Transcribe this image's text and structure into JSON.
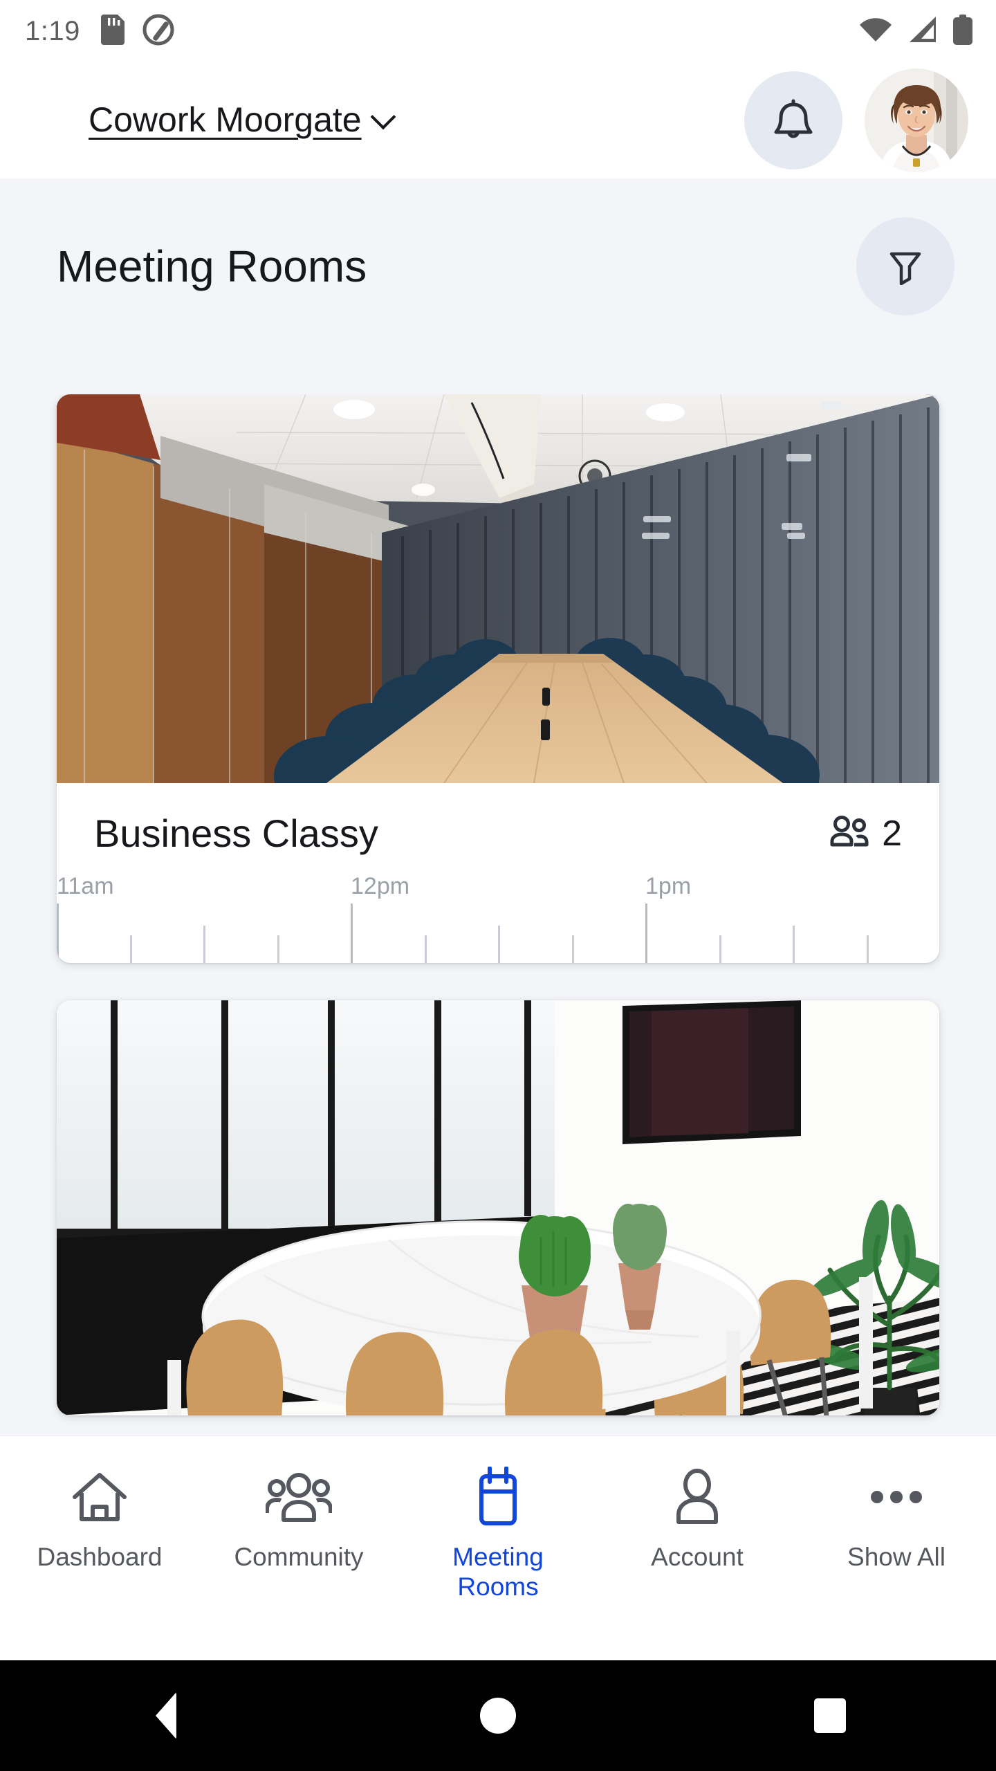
{
  "status_bar": {
    "time": "1:19",
    "left_icons": [
      "sd-card-icon",
      "adaptive-icon"
    ],
    "right_icons": [
      "wifi-icon",
      "cellular-signal-icon",
      "battery-icon"
    ]
  },
  "header": {
    "venue_name": "Cowork Moorgate",
    "chevron": "chevron-down-icon",
    "notifications_icon": "bell-icon",
    "avatar_alt": "user-avatar"
  },
  "page": {
    "title": "Meeting Rooms",
    "filter_icon": "filter-funnel-icon"
  },
  "rooms": [
    {
      "name": "Business Classy",
      "capacity": "2",
      "capacity_icon": "people-icon",
      "photo": "boardroom-wood-table-navy-chairs",
      "timeline": {
        "labels": [
          "11am",
          "12pm",
          "1pm"
        ],
        "label_positions_pct": [
          0,
          33.33,
          66.66
        ],
        "ticks": [
          {
            "pos_pct": 0,
            "size": "major"
          },
          {
            "pos_pct": 8.33,
            "size": "minor"
          },
          {
            "pos_pct": 16.66,
            "size": "mid"
          },
          {
            "pos_pct": 25,
            "size": "minor"
          },
          {
            "pos_pct": 33.33,
            "size": "major"
          },
          {
            "pos_pct": 41.66,
            "size": "minor"
          },
          {
            "pos_pct": 50,
            "size": "mid"
          },
          {
            "pos_pct": 58.33,
            "size": "minor"
          },
          {
            "pos_pct": 66.66,
            "size": "major"
          },
          {
            "pos_pct": 75,
            "size": "minor"
          },
          {
            "pos_pct": 83.33,
            "size": "mid"
          },
          {
            "pos_pct": 91.66,
            "size": "minor"
          }
        ]
      }
    },
    {
      "name": "",
      "capacity": "",
      "capacity_icon": "people-icon",
      "photo": "white-oval-table-wood-chairs-plants",
      "timeline": null
    }
  ],
  "bottom_nav": {
    "items": [
      {
        "label": "Dashboard",
        "icon": "home-icon",
        "active": false
      },
      {
        "label": "Community",
        "icon": "people-icon",
        "active": false
      },
      {
        "label": "Meeting Rooms",
        "icon": "calendar-icon",
        "active": true
      },
      {
        "label": "Account",
        "icon": "person-icon",
        "active": false
      },
      {
        "label": "Show All",
        "icon": "ellipsis-icon",
        "active": false
      }
    ],
    "active_color": "#1246da",
    "inactive_color": "#55595f"
  },
  "android_nav": {
    "back": "back-triangle-icon",
    "home": "home-circle-icon",
    "recents": "recents-square-icon"
  },
  "colors": {
    "page_background": "#f3f5f8",
    "surface": "#ffffff",
    "accent": "#1246da",
    "icon_circle": "#e4e9f2",
    "text_primary": "#16181c",
    "text_muted": "#9aa0a8"
  }
}
